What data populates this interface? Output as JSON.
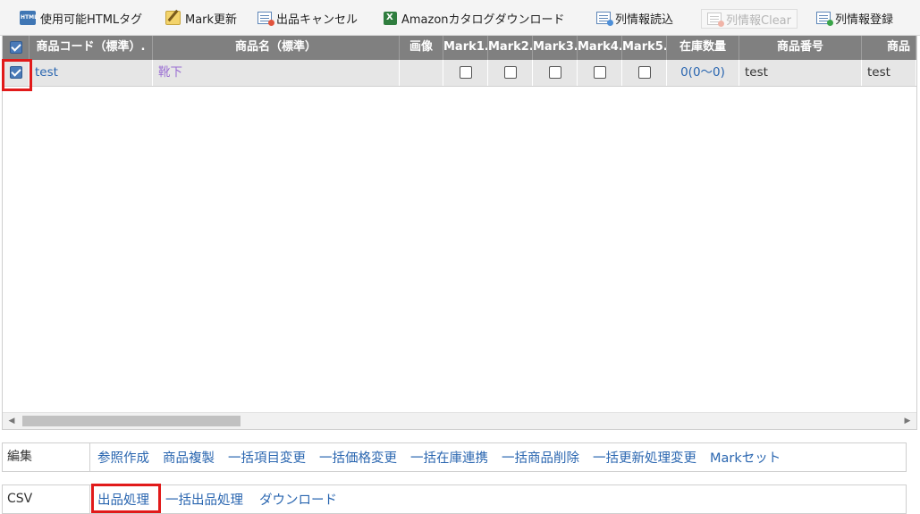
{
  "toolbar": {
    "html_tags": "使用可能HTMLタグ",
    "mark_update": "Mark更新",
    "cancel_listing": "出品キャンセル",
    "amazon_catalog": "Amazonカタログダウンロード",
    "load_columns": "列情報読込",
    "clear_columns": "列情報Clear",
    "save_columns": "列情報登録"
  },
  "grid": {
    "headers": [
      "商品コード（標準）.",
      "商品名（標準）",
      "画像",
      "Mark1.",
      "Mark2.",
      "Mark3.",
      "Mark4.",
      "Mark5.",
      "在庫数量",
      "商品番号",
      "商品"
    ],
    "rows": [
      {
        "selected": true,
        "code": "test",
        "name": "靴下",
        "image": "",
        "marks": [
          false,
          false,
          false,
          false,
          false
        ],
        "stock": "0(0〜0)",
        "product_number": "test",
        "extra": "test"
      }
    ]
  },
  "edit_panel": {
    "label": "編集",
    "actions": [
      "参照作成",
      "商品複製",
      "一括項目変更",
      "一括価格変更",
      "一括在庫連携",
      "一括商品削除",
      "一括更新処理変更",
      "Markセット"
    ]
  },
  "csv_panel": {
    "label": "CSV",
    "actions": [
      "出品処理",
      "一括出品処理",
      "ダウンロード"
    ]
  },
  "colors": {
    "header_bg": "#808080",
    "row_bg": "#e6e6e6",
    "link": "#2a66b0",
    "highlight": "#e11a1a"
  }
}
